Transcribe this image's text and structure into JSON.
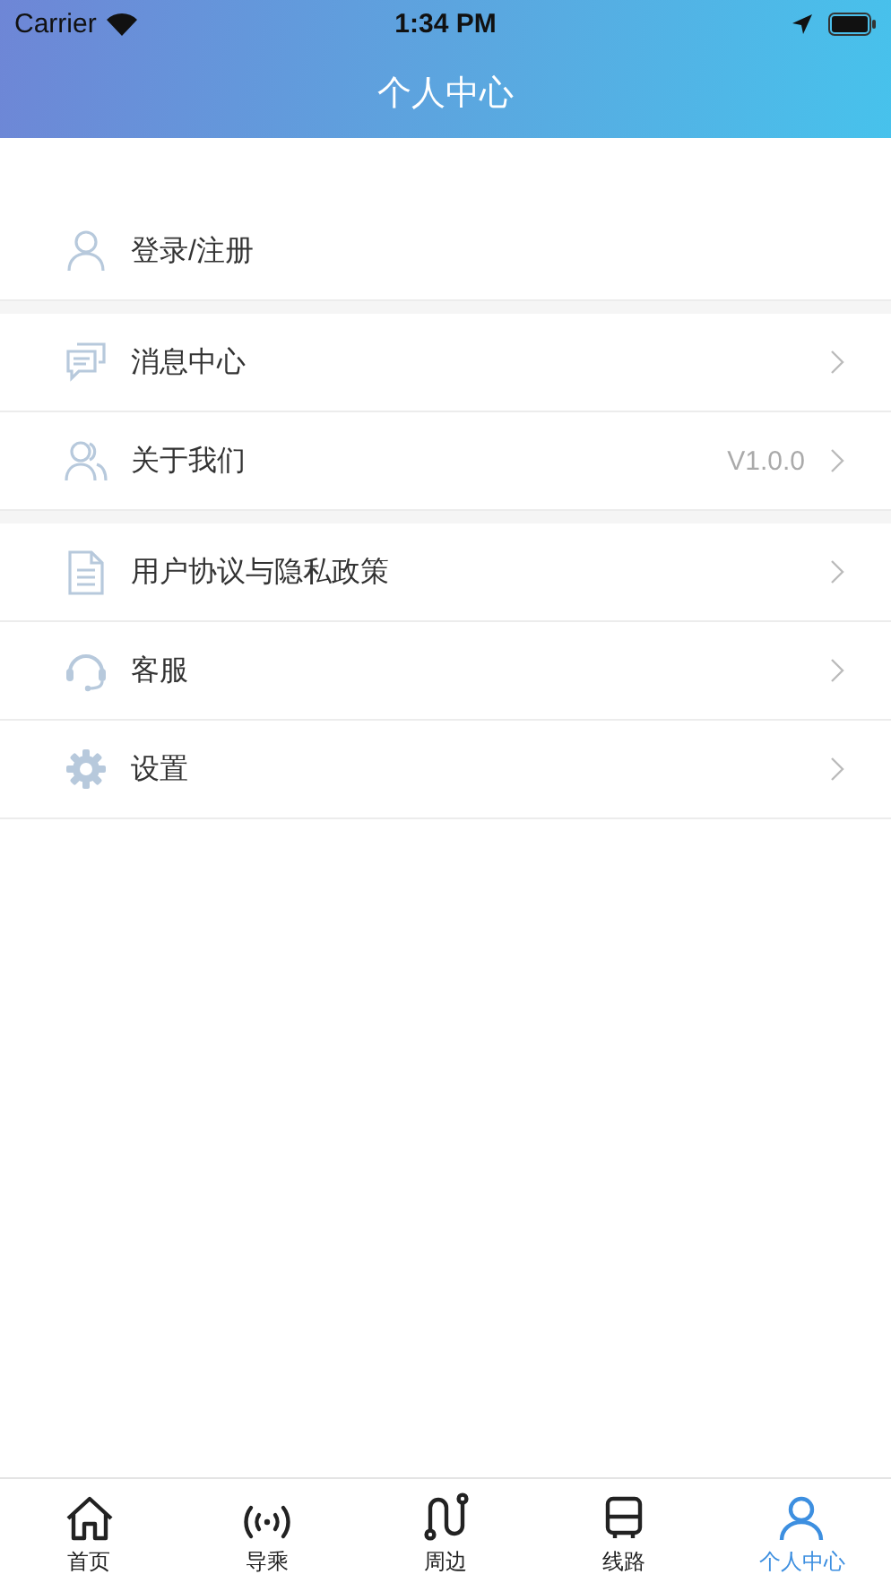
{
  "status_bar": {
    "carrier": "Carrier",
    "time": "1:34 PM"
  },
  "nav_bar": {
    "title": "个人中心"
  },
  "groups": [
    {
      "items": [
        {
          "label": "登录/注册",
          "has_arrow": false
        }
      ]
    },
    {
      "items": [
        {
          "label": "消息中心",
          "has_arrow": true
        },
        {
          "label": "关于我们",
          "value": "V1.0.0",
          "has_arrow": true
        }
      ]
    },
    {
      "items": [
        {
          "label": "用户协议与隐私政策",
          "has_arrow": true
        },
        {
          "label": "客服",
          "has_arrow": true
        },
        {
          "label": "设置",
          "has_arrow": true
        }
      ]
    }
  ],
  "tab_bar": [
    {
      "label": "首页",
      "selected": false
    },
    {
      "label": "导乘",
      "selected": false
    },
    {
      "label": "周边",
      "selected": false
    },
    {
      "label": "线路",
      "selected": false
    },
    {
      "label": "个人中心",
      "selected": true
    }
  ]
}
